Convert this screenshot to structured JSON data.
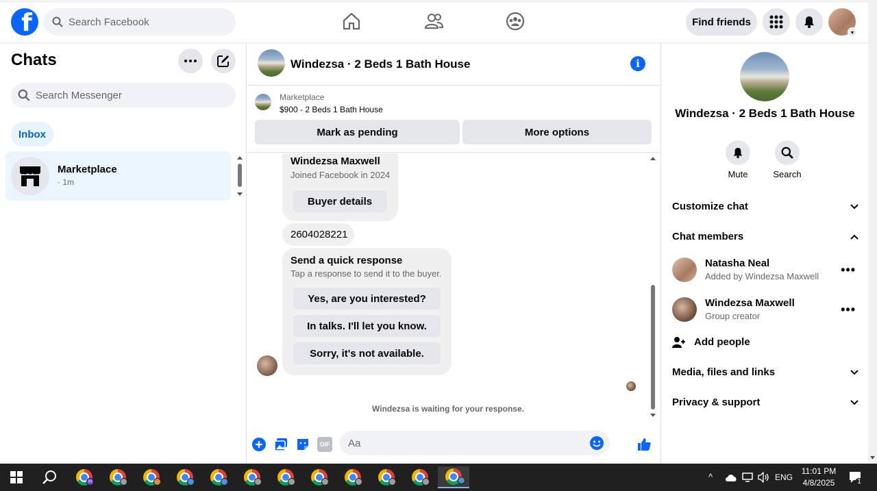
{
  "topbar": {
    "search_placeholder": "Search Facebook",
    "find_friends": "Find friends"
  },
  "left": {
    "title": "Chats",
    "search_placeholder": "Search Messenger",
    "inbox": "Inbox",
    "chats": [
      {
        "name": "Marketplace",
        "time": "· 1m"
      }
    ]
  },
  "conversation": {
    "title": "Windezsa · 2 Beds 1 Bath House",
    "marketplace_label": "Marketplace",
    "listing": "$900 - 2 Beds 1 Bath House",
    "mark_pending": "Mark as pending",
    "more_options": "More options",
    "buyer_name": "Windezsa Maxwell",
    "buyer_joined": "Joined Facebook in 2024",
    "buyer_details": "Buyer details",
    "phone": "2604028221",
    "quick_title": "Send a quick response",
    "quick_sub": "Tap a response to send it to the buyer.",
    "quick_responses": [
      "Yes, are you interested?",
      "In talks. I'll let you know.",
      "Sorry, it's not available."
    ],
    "waiting": "Windezsa is waiting for your response.",
    "composer_placeholder": "Aa",
    "gif": "GIF"
  },
  "details": {
    "title": "Windezsa · 2 Beds 1 Bath House",
    "mute": "Mute",
    "search": "Search",
    "customize": "Customize chat",
    "members_header": "Chat members",
    "members": [
      {
        "name": "Natasha Neal",
        "sub": "Added by Windezsa Maxwell"
      },
      {
        "name": "Windezsa Maxwell",
        "sub": "Group creator"
      }
    ],
    "add_people": "Add people",
    "media": "Media, files and links",
    "privacy": "Privacy & support"
  },
  "taskbar": {
    "lang": "ENG",
    "time": "11:01 PM",
    "date": "4/8/2025",
    "notif_count": "1",
    "first_app_badge": "H"
  },
  "colors": {
    "accent": "#0866ff",
    "inbox_bg": "#e7f3ff",
    "selected_chat": "#ebf5ff"
  }
}
